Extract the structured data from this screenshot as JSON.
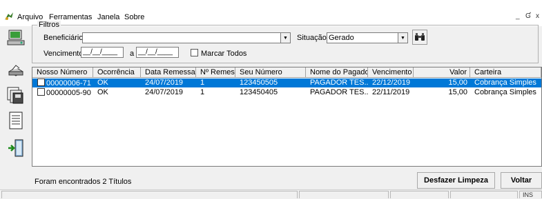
{
  "menu": {
    "items": [
      "Arquivo",
      "Ferramentas",
      "Janela",
      "Sobre"
    ],
    "window_controls": [
      "_",
      "Ɠ",
      "x"
    ]
  },
  "filters": {
    "legend": "Filtros",
    "beneficiario_label": "Beneficiário:",
    "beneficiario_value": "",
    "situacao_label": "Situação:",
    "situacao_value": "Gerado",
    "vencimento_label": "Vencimento:",
    "vencimento_from": "__/__/____",
    "a_label": "a",
    "vencimento_to": "__/__/____",
    "marcar_todos_label": "Marcar Todos"
  },
  "table": {
    "columns": [
      "Nosso Número",
      "Ocorrência",
      "Data Remessa",
      "Nº Remessa",
      "Seu Número",
      "Nome do Pagador",
      "Vencimento",
      "Valor",
      "Carteira"
    ],
    "rows": [
      {
        "nosso_numero": "00000006-71",
        "ocorrencia": "OK",
        "data_remessa": "24/07/2019",
        "n_remessa": "1",
        "seu_numero": "123450505",
        "pagador": "PAGADOR TES...",
        "vencimento": "22/12/2019",
        "valor": "15,00",
        "carteira": "Cobrança Simples",
        "selected": true
      },
      {
        "nosso_numero": "00000005-90",
        "ocorrencia": "OK",
        "data_remessa": "24/07/2019",
        "n_remessa": "1",
        "seu_numero": "123450405",
        "pagador": "PAGADOR TES...",
        "vencimento": "22/11/2019",
        "valor": "15,00",
        "carteira": "Cobrança Simples",
        "selected": false
      }
    ]
  },
  "footer": {
    "status_text": "Foram encontrados 2 Títulos",
    "undo_button": "Desfazer Limpeza",
    "back_button": "Voltar"
  },
  "statusbar": {
    "ins": "INS"
  },
  "colors": {
    "selection": "#0078d7"
  }
}
